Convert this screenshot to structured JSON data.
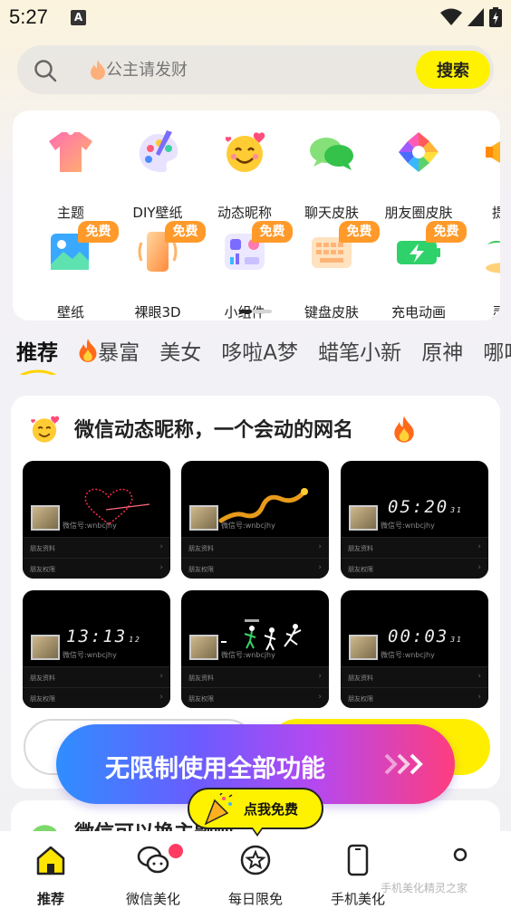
{
  "status_bar": {
    "time": "5:27",
    "notification_letter": "A"
  },
  "search": {
    "placeholder": "公主请发财",
    "button_label": "搜索"
  },
  "categories": {
    "free_label": "免费",
    "row1": [
      {
        "label": "主题",
        "icon": "tshirt-icon"
      },
      {
        "label": "DIY壁纸",
        "icon": "palette-icon"
      },
      {
        "label": "动态昵称",
        "icon": "smiley-hearts-icon"
      },
      {
        "label": "聊天皮肤",
        "icon": "chat-bubbles-icon"
      },
      {
        "label": "朋友圈皮肤",
        "icon": "camera-aperture-icon"
      },
      {
        "label": "提示",
        "icon": "megaphone-icon"
      }
    ],
    "row2": [
      {
        "label": "壁纸",
        "icon": "picture-icon",
        "free": true
      },
      {
        "label": "裸眼3D",
        "icon": "phone-3d-icon",
        "free": true
      },
      {
        "label": "小组件",
        "icon": "widget-icon",
        "free": true
      },
      {
        "label": "键盘皮肤",
        "icon": "keyboard-icon",
        "free": true
      },
      {
        "label": "充电动画",
        "icon": "battery-charging-icon",
        "free": true
      },
      {
        "label": "灵动",
        "icon": "palm-island-icon",
        "free": false
      }
    ]
  },
  "tabs": [
    "推荐",
    "暴富",
    "美女",
    "哆啦A梦",
    "蜡笔小新",
    "原神",
    "哪吒"
  ],
  "feature": {
    "title": "微信动态昵称，一个会动的网名",
    "thumb_wechat_id": "微信号:wnbcjhy",
    "thumb_row1": "朋友资料",
    "thumb_row2": "朋友权限",
    "thumbs": [
      {
        "anim": "heart"
      },
      {
        "anim": "dragon"
      },
      {
        "anim": "clock",
        "clock": "05:20",
        "seconds": "31"
      },
      {
        "anim": "clock",
        "clock": "13:13",
        "seconds": "12"
      },
      {
        "anim": "runners"
      },
      {
        "anim": "clock",
        "clock": "00:03",
        "seconds": "31"
      }
    ]
  },
  "promo": {
    "text": "无限制使用全部功能"
  },
  "next_card": {
    "title": "微信可以换主题啦"
  },
  "claim_bubble": {
    "text": "点我免费"
  },
  "bottom_nav": [
    {
      "label": "推荐",
      "icon": "home-icon",
      "active": true
    },
    {
      "label": "微信美化",
      "icon": "wechat-icon",
      "badge": true
    },
    {
      "label": "每日限免",
      "icon": "star-badge-icon"
    },
    {
      "label": "手机美化",
      "icon": "phone-icon"
    },
    {
      "label": "",
      "icon": "circle-icon"
    }
  ],
  "watermark": "手机美化精灵之家",
  "colors": {
    "accent_yellow": "#fff200",
    "free_badge": "#ff9a2a",
    "promo_start": "#2f8eff",
    "promo_end": "#ff3d7e",
    "nav_badge": "#ff3b64"
  }
}
